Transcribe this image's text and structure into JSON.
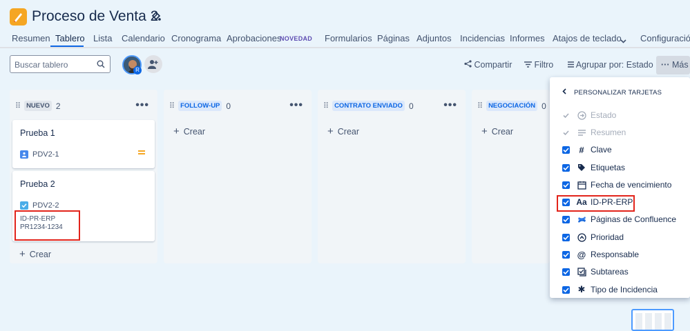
{
  "project": {
    "title": "Proceso de Venta 2"
  },
  "tabs": [
    {
      "label": "Resumen"
    },
    {
      "label": "Tablero"
    },
    {
      "label": "Lista"
    },
    {
      "label": "Calendario"
    },
    {
      "label": "Cronograma"
    },
    {
      "label": "Aprobaciones"
    },
    {
      "label": "Formularios"
    },
    {
      "label": "Páginas"
    },
    {
      "label": "Adjuntos"
    },
    {
      "label": "Incidencias"
    },
    {
      "label": "Informes"
    },
    {
      "label": "Atajos de teclado"
    },
    {
      "label": "Configuración"
    }
  ],
  "new_badge": "NOVEDAD",
  "toolbar": {
    "search_placeholder": "Buscar tablero",
    "avatar_badge": "R",
    "share": "Compartir",
    "filter": "Filtro",
    "group_by": "Agrupar por: Estado",
    "more": "Más"
  },
  "columns": [
    {
      "name": "NUEVO",
      "count": "2",
      "create": "Crear"
    },
    {
      "name": "FOLLOW-UP",
      "count": "0",
      "create": "Crear"
    },
    {
      "name": "CONTRATO ENVIADO",
      "count": "0",
      "create": "Crear"
    },
    {
      "name": "NEGOCIACIÓN",
      "count": "0",
      "create": "Crear"
    }
  ],
  "cards": [
    {
      "title": "Prueba 1",
      "key": "PDV2-1"
    },
    {
      "title": "Prueba 2",
      "key": "PDV2-2",
      "field_name": "ID-PR-ERP",
      "field_value": "PR1234-1234"
    }
  ],
  "panel": {
    "title": "PERSONALIZAR TARJETAS",
    "options": [
      {
        "label": "Estado",
        "icon": "status-icon",
        "checked": true,
        "disabled": true
      },
      {
        "label": "Resumen",
        "icon": "summary-icon",
        "checked": true,
        "disabled": true
      },
      {
        "label": "Clave",
        "icon": "hash-icon",
        "checked": true,
        "disabled": false
      },
      {
        "label": "Etiquetas",
        "icon": "tag-icon",
        "checked": true,
        "disabled": false
      },
      {
        "label": "Fecha de vencimiento",
        "icon": "calendar-icon",
        "checked": true,
        "disabled": false
      },
      {
        "label": "ID-PR-ERP",
        "icon": "text-field-icon",
        "glyph": "Aa",
        "checked": true,
        "disabled": false
      },
      {
        "label": "Páginas de Confluence",
        "icon": "confluence-icon",
        "checked": true,
        "disabled": false
      },
      {
        "label": "Prioridad",
        "icon": "priority-icon",
        "checked": true,
        "disabled": false
      },
      {
        "label": "Responsable",
        "icon": "at-icon",
        "checked": true,
        "disabled": false
      },
      {
        "label": "Subtareas",
        "icon": "subtasks-icon",
        "checked": true,
        "disabled": false
      },
      {
        "label": "Tipo de Incidencia",
        "icon": "asterisk-icon",
        "checked": true,
        "disabled": false
      }
    ]
  },
  "colors": {
    "accent": "#0c66e4",
    "highlight": "#e2231a",
    "project_icon": "#f5a623"
  }
}
